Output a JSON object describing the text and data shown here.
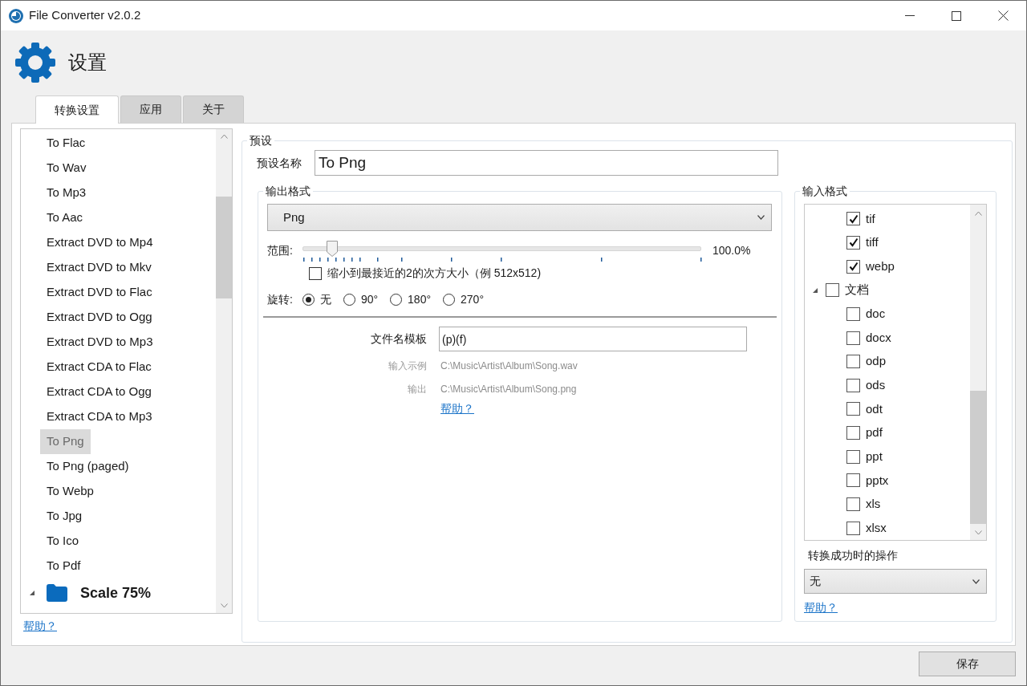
{
  "window": {
    "title": "File Converter v2.0.2"
  },
  "header": {
    "title": "设置"
  },
  "tabs": [
    {
      "label": "转换设置",
      "selected": true
    },
    {
      "label": "应用",
      "selected": false
    },
    {
      "label": "关于",
      "selected": false
    }
  ],
  "presets": [
    {
      "kind": "preset",
      "label": "To Flac",
      "selected": false
    },
    {
      "kind": "preset",
      "label": "To Wav",
      "selected": false
    },
    {
      "kind": "preset",
      "label": "To Mp3",
      "selected": false
    },
    {
      "kind": "preset",
      "label": "To Aac",
      "selected": false
    },
    {
      "kind": "preset",
      "label": "Extract DVD to Mp4",
      "selected": false
    },
    {
      "kind": "preset",
      "label": "Extract DVD to Mkv",
      "selected": false
    },
    {
      "kind": "preset",
      "label": "Extract DVD to Flac",
      "selected": false
    },
    {
      "kind": "preset",
      "label": "Extract DVD to Ogg",
      "selected": false
    },
    {
      "kind": "preset",
      "label": "Extract DVD to Mp3",
      "selected": false
    },
    {
      "kind": "preset",
      "label": "Extract CDA to Flac",
      "selected": false
    },
    {
      "kind": "preset",
      "label": "Extract CDA to Ogg",
      "selected": false
    },
    {
      "kind": "preset",
      "label": "Extract CDA to Mp3",
      "selected": false
    },
    {
      "kind": "preset",
      "label": "To Png",
      "selected": true
    },
    {
      "kind": "preset",
      "label": "To Png (paged)",
      "selected": false
    },
    {
      "kind": "preset",
      "label": "To Webp",
      "selected": false
    },
    {
      "kind": "preset",
      "label": "To Jpg",
      "selected": false
    },
    {
      "kind": "preset",
      "label": "To Ico",
      "selected": false
    },
    {
      "kind": "preset",
      "label": "To Pdf",
      "selected": false
    },
    {
      "kind": "folder",
      "label": "Scale 75%",
      "selected": false,
      "expanded": true
    }
  ],
  "left_help_link": "帮助？",
  "preset_group": {
    "title": "预设",
    "name_label": "预设名称",
    "name_value": "To Png"
  },
  "output_format": {
    "title": "输出格式",
    "format": "Png",
    "scale_label": "范围:",
    "scale": {
      "level": 0.06,
      "reading": "100.0%"
    },
    "resize_option": {
      "label": "缩小到最接近的2的次方大小（例 512x512)",
      "checked": false
    },
    "rotation_label": "旋转:",
    "rotation": [
      {
        "label": "无",
        "selected": true
      },
      {
        "label": "90°",
        "selected": false
      },
      {
        "label": "180°",
        "selected": false
      },
      {
        "label": "270°",
        "selected": false
      }
    ],
    "template_label": "文件名模板",
    "template_value": "(p)(f)",
    "example_input_label": "输入示例",
    "example_input": "C:\\Music\\Artist\\Album\\Song.wav",
    "example_output_label": "输出",
    "example_output": "C:\\Music\\Artist\\Album\\Song.png",
    "help_link": "帮助？"
  },
  "input_formats": {
    "title": "输入格式",
    "items": [
      {
        "label": "tif",
        "checked": true
      },
      {
        "label": "tiff",
        "checked": true
      },
      {
        "label": "webp",
        "checked": true
      },
      {
        "label": "文档",
        "checked": false,
        "expanded": true,
        "children": [
          {
            "label": "doc",
            "checked": false
          },
          {
            "label": "docx",
            "checked": false
          },
          {
            "label": "odp",
            "checked": false
          },
          {
            "label": "ods",
            "checked": false
          },
          {
            "label": "odt",
            "checked": false
          },
          {
            "label": "pdf",
            "checked": false
          },
          {
            "label": "ppt",
            "checked": false
          },
          {
            "label": "pptx",
            "checked": false
          },
          {
            "label": "xls",
            "checked": false
          },
          {
            "label": "xlsx",
            "checked": false
          }
        ]
      }
    ]
  },
  "on_success_label": "转换成功时的操作",
  "on_success_value": "无",
  "right_help_link": "帮助？",
  "save_button": "保存"
}
